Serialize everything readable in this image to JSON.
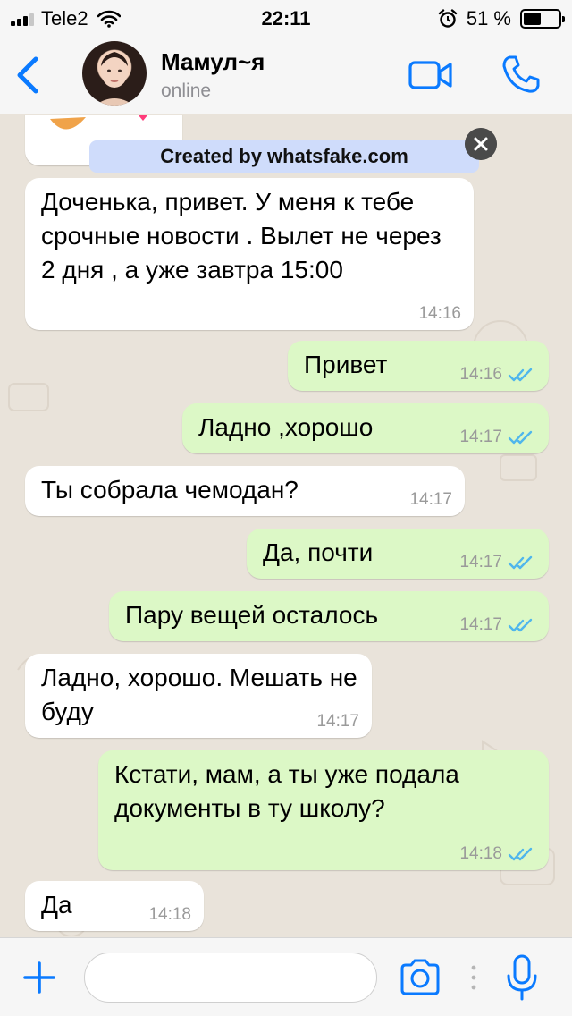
{
  "status_bar": {
    "carrier": "Tele2",
    "time": "22:11",
    "battery": "51 %",
    "battery_level": 0.51
  },
  "header": {
    "contact_name": "Мамул~я",
    "contact_status": "online",
    "icons": [
      "back-chevron-icon",
      "avatar",
      "video-call-icon",
      "phone-icon"
    ]
  },
  "watermark": {
    "text": "Created by whatsfake.com"
  },
  "messages": [
    {
      "dir": "in",
      "text": "Доченька, привет. У меня к тебе срочные новости . Вылет не через 2 дня , а уже завтра 15:00",
      "time": "14:16"
    },
    {
      "dir": "out",
      "text": "Привет",
      "time": "14:16",
      "read": true
    },
    {
      "dir": "out",
      "text": "Ладно ,хорошо",
      "time": "14:17",
      "read": true
    },
    {
      "dir": "in",
      "text": "Ты собрала чемодан?",
      "time": "14:17"
    },
    {
      "dir": "out",
      "text": "Да, почти",
      "time": "14:17",
      "read": true
    },
    {
      "dir": "out",
      "text": "Пару вещей осталось",
      "time": "14:17",
      "read": true
    },
    {
      "dir": "in",
      "text": "Ладно, хорошо. Мешать не буду",
      "time": "14:17"
    },
    {
      "dir": "out",
      "text": "Кстати, мам, а ты уже подала документы в ту школу?",
      "time": "14:18",
      "read": true
    },
    {
      "dir": "in",
      "text": "Да",
      "time": "14:18"
    }
  ],
  "input_bar": {
    "placeholder": "",
    "icons": [
      "plus-icon",
      "camera-icon",
      "more-icon",
      "microphone-icon"
    ]
  },
  "colors": {
    "accent": "#0a7aff",
    "outgoing_bubble": "#dcf8c6",
    "incoming_bubble": "#ffffff",
    "chat_background": "#e9e3da",
    "read_ticks": "#4fb6ec"
  }
}
